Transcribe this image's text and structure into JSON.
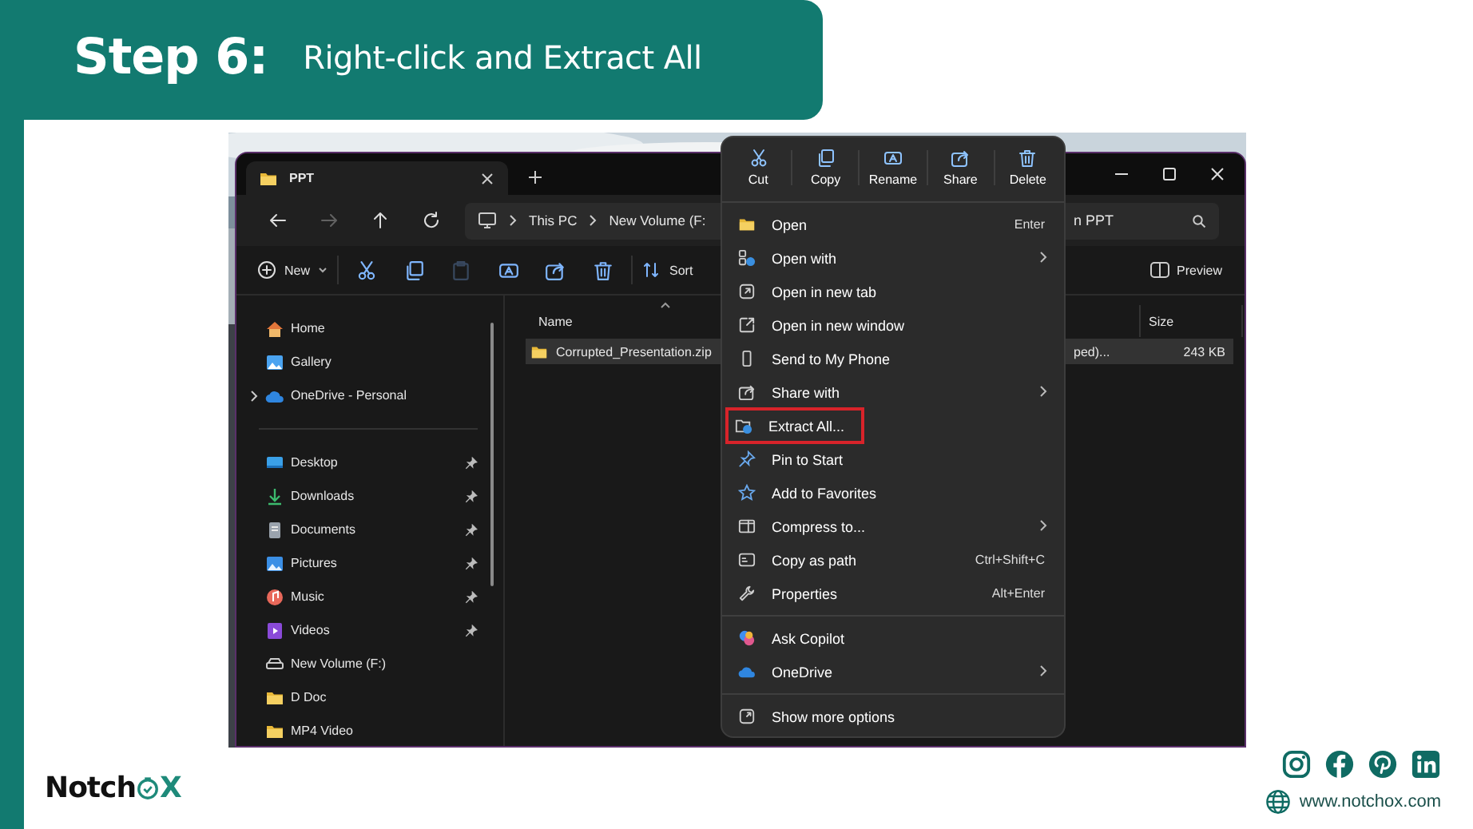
{
  "header": {
    "step": "Step 6:",
    "title": "Right-click and Extract All"
  },
  "explorer": {
    "tab": {
      "title": "PPT"
    },
    "nav": [
      {
        "kind": "back",
        "disabled": false
      },
      {
        "kind": "forward",
        "disabled": true
      },
      {
        "kind": "up",
        "disabled": false
      },
      {
        "kind": "refresh",
        "disabled": false
      }
    ],
    "address": {
      "crumbs": [
        "This PC",
        "New Volume (F:"
      ]
    },
    "search": {
      "value": "n PPT"
    },
    "toolbar": [
      {
        "kind": "new",
        "label": "New",
        "disabled": false
      },
      {
        "kind": "cut",
        "disabled": false
      },
      {
        "kind": "copy",
        "disabled": false
      },
      {
        "kind": "paste",
        "disabled": true
      },
      {
        "kind": "rename",
        "disabled": false
      },
      {
        "kind": "share",
        "disabled": false
      },
      {
        "kind": "delete",
        "disabled": false
      },
      {
        "kind": "sort",
        "label": "Sort",
        "disabled": false
      }
    ],
    "preview": {
      "label": "Preview"
    },
    "sidebar": [
      [
        {
          "label": "Home",
          "kind": "home",
          "expandable": false,
          "pinned": false
        },
        {
          "label": "Gallery",
          "kind": "gallery",
          "expandable": false,
          "pinned": false
        },
        {
          "label": "OneDrive - Personal",
          "kind": "cloud",
          "expandable": true,
          "pinned": false
        }
      ],
      [
        {
          "label": "Desktop",
          "kind": "desktop",
          "expandable": false,
          "pinned": true
        },
        {
          "label": "Downloads",
          "kind": "downloads",
          "expandable": false,
          "pinned": true
        },
        {
          "label": "Documents",
          "kind": "documents",
          "expandable": false,
          "pinned": true
        },
        {
          "label": "Pictures",
          "kind": "pictures",
          "expandable": false,
          "pinned": true
        },
        {
          "label": "Music",
          "kind": "music",
          "expandable": false,
          "pinned": true
        },
        {
          "label": "Videos",
          "kind": "videos",
          "expandable": false,
          "pinned": true
        },
        {
          "label": "New Volume (F:)",
          "kind": "drive",
          "expandable": false,
          "pinned": false
        },
        {
          "label": "D Doc",
          "kind": "folder",
          "expandable": false,
          "pinned": false
        },
        {
          "label": "MP4 Video",
          "kind": "folder",
          "expandable": false,
          "pinned": false
        }
      ]
    ],
    "columns": [
      "Name",
      "Size"
    ],
    "rows": [
      {
        "name": "Corrupted_Presentation.zip",
        "type": "ped)...",
        "size": "243 KB",
        "selected": true
      }
    ]
  },
  "context_menu": {
    "actions": [
      {
        "label": "Cut",
        "kind": "cut"
      },
      {
        "label": "Copy",
        "kind": "copy"
      },
      {
        "label": "Rename",
        "kind": "rename"
      },
      {
        "label": "Share",
        "kind": "share"
      },
      {
        "label": "Delete",
        "kind": "delete"
      }
    ],
    "groups": [
      [
        {
          "label": "Open",
          "kind": "folder",
          "shortcut": "Enter",
          "submenu": false,
          "highlighted": false
        },
        {
          "label": "Open with",
          "kind": "openwith",
          "submenu": true,
          "highlighted": false
        },
        {
          "label": "Open in new tab",
          "kind": "newtab",
          "submenu": false,
          "highlighted": false
        },
        {
          "label": "Open in new window",
          "kind": "newwindow",
          "submenu": false,
          "highlighted": false
        },
        {
          "label": "Send to My Phone",
          "kind": "phone",
          "submenu": false,
          "highlighted": false
        },
        {
          "label": "Share with",
          "kind": "share",
          "submenu": true,
          "highlighted": false
        },
        {
          "label": "Extract All...",
          "kind": "extract",
          "submenu": false,
          "highlighted": true
        },
        {
          "label": "Pin to Start",
          "kind": "pin",
          "submenu": false,
          "highlighted": false
        },
        {
          "label": "Add to Favorites",
          "kind": "star",
          "submenu": false,
          "highlighted": false
        },
        {
          "label": "Compress to...",
          "kind": "compress",
          "submenu": true,
          "highlighted": false
        },
        {
          "label": "Copy as path",
          "kind": "path",
          "shortcut": "Ctrl+Shift+C",
          "submenu": false,
          "highlighted": false
        },
        {
          "label": "Properties",
          "kind": "wrench",
          "shortcut": "Alt+Enter",
          "submenu": false,
          "highlighted": false
        }
      ],
      [
        {
          "label": "Ask Copilot",
          "kind": "copilot",
          "submenu": false,
          "highlighted": false
        },
        {
          "label": "OneDrive",
          "kind": "cloud",
          "submenu": true,
          "highlighted": false
        }
      ],
      [
        {
          "label": "Show more options",
          "kind": "more",
          "submenu": false,
          "highlighted": false
        }
      ]
    ]
  },
  "footer": {
    "brand_start": "Notch",
    "brand_end": "X",
    "website": "www.notchox.com"
  }
}
